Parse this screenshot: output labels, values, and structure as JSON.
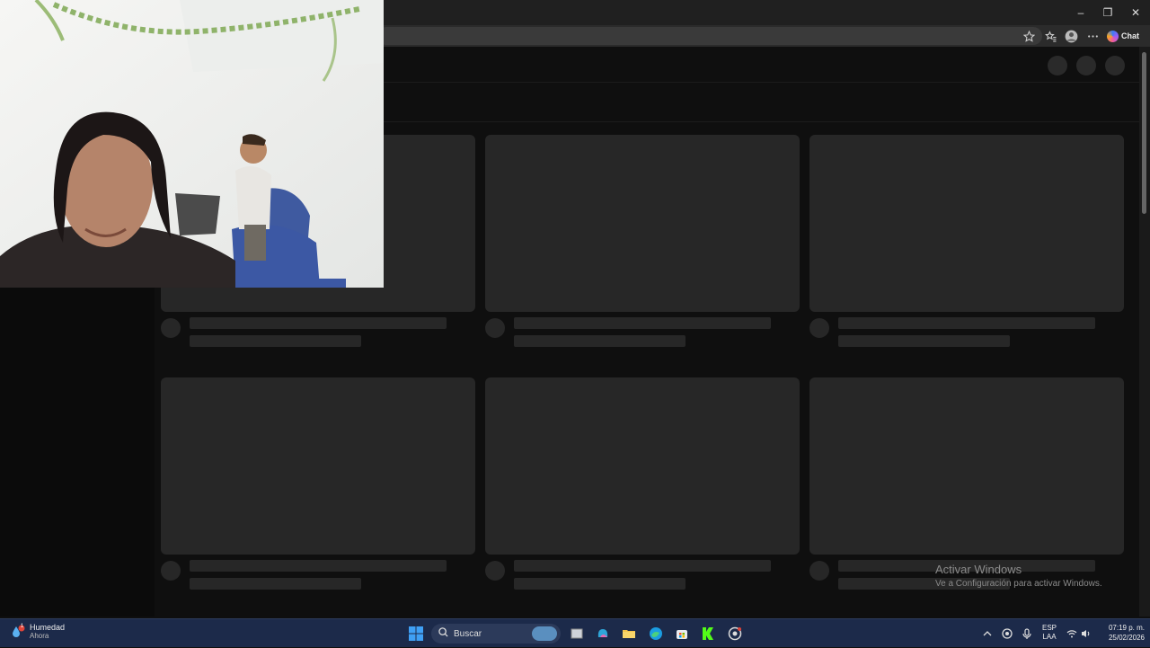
{
  "window_controls": {
    "minimize": "–",
    "maximize": "❐",
    "close": "✕"
  },
  "browser": {
    "chat_label": "Chat"
  },
  "watermark": {
    "title": "Activar Windows",
    "subtitle": "Ve a Configuración para activar Windows."
  },
  "taskbar": {
    "weather_title": "Humedad",
    "weather_sub": "Ahora",
    "weather_badge": "1",
    "search_placeholder": "Buscar",
    "language_top": "ESP",
    "language_bottom": "LAA",
    "time": "07:19 p. m.",
    "date": "25/02/2026"
  },
  "colors": {
    "background": "#0f0f0f",
    "skeleton": "#272727",
    "taskbar": "#1c2a4a"
  },
  "icons": [
    "star-icon",
    "favorites-icon",
    "profile-icon",
    "more-icon",
    "copilot-icon",
    "windows-start-icon",
    "search-icon",
    "task-view-icon",
    "copilot-app-icon",
    "file-explorer-icon",
    "edge-icon",
    "store-icon",
    "kick-icon",
    "chrome-icon"
  ]
}
